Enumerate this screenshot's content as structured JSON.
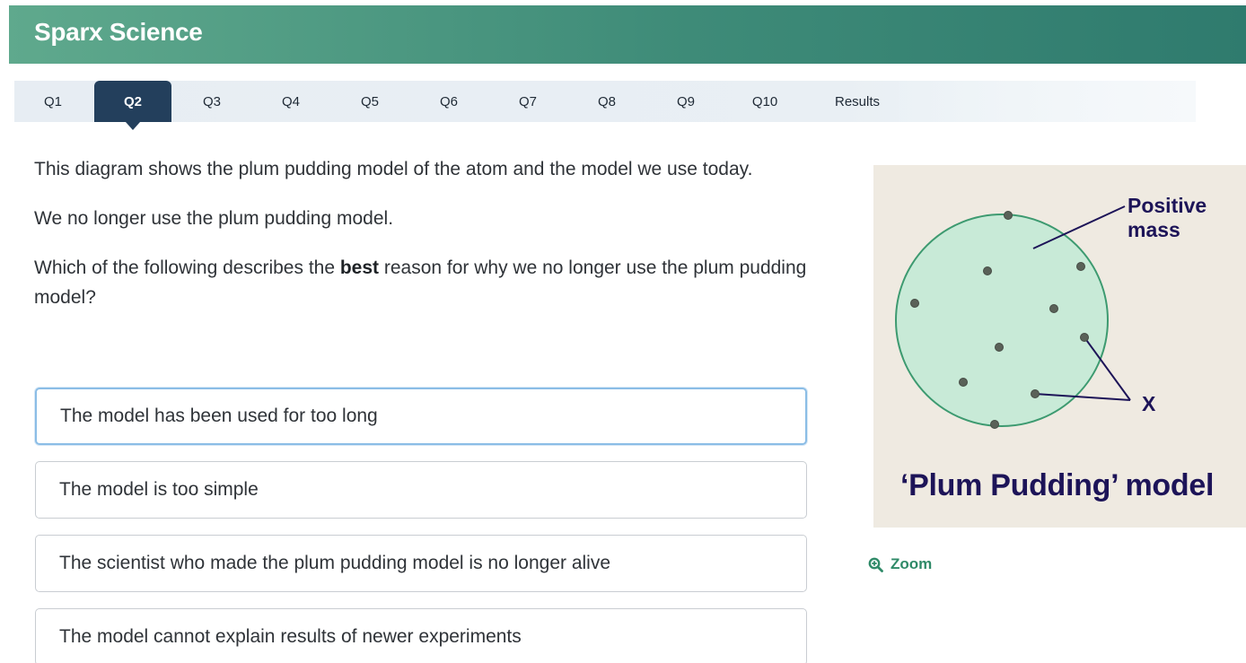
{
  "app": {
    "title": "Sparx Science"
  },
  "tabs": [
    {
      "label": "Q1",
      "active": false
    },
    {
      "label": "Q2",
      "active": true
    },
    {
      "label": "Q3",
      "active": false
    },
    {
      "label": "Q4",
      "active": false
    },
    {
      "label": "Q5",
      "active": false
    },
    {
      "label": "Q6",
      "active": false
    },
    {
      "label": "Q7",
      "active": false
    },
    {
      "label": "Q8",
      "active": false
    },
    {
      "label": "Q9",
      "active": false
    },
    {
      "label": "Q10",
      "active": false
    },
    {
      "label": "Results",
      "active": false
    }
  ],
  "question": {
    "para1": "This diagram shows the plum pudding model of the atom and the model we use today.",
    "para2": "We no longer use the plum pudding model.",
    "para3_before": "Which of the following describes the ",
    "para3_bold": "best",
    "para3_after": " reason for why we no longer use the plum pudding model?"
  },
  "answers": [
    {
      "text": "The model has been used for too long",
      "selected": true
    },
    {
      "text": "The model is too simple",
      "selected": false
    },
    {
      "text": "The scientist who made the plum pudding model is no longer alive",
      "selected": false
    },
    {
      "text": "The model cannot explain results of newer experiments",
      "selected": false
    }
  ],
  "figure": {
    "label_positive_line1": "Positive",
    "label_positive_line2": "mass",
    "label_x": "X",
    "caption": "‘Plum Pudding’ model"
  },
  "zoom": {
    "label": "Zoom",
    "icon": "zoom-in-icon"
  },
  "colors": {
    "header_green": "#3e8b78",
    "tab_active": "#233f5c",
    "sphere_fill": "#c8ead7",
    "sphere_stroke": "#3d9a70",
    "label_navy": "#1d1458",
    "zoom_green": "#2f8a68"
  }
}
